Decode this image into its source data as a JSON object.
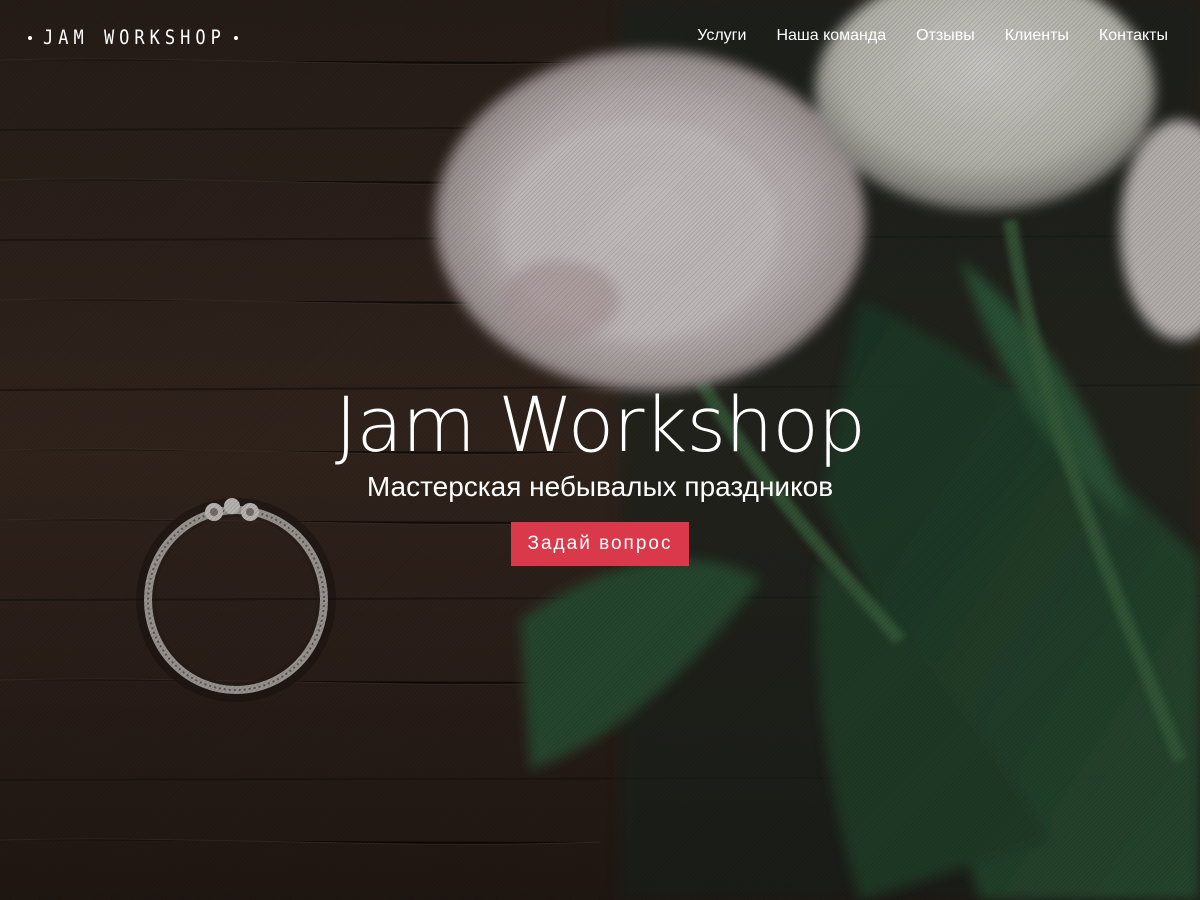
{
  "brand": {
    "logo_text": "JAM WORKSHOP"
  },
  "nav": {
    "items": [
      {
        "label": "Услуги"
      },
      {
        "label": "Наша команда"
      },
      {
        "label": "Отзывы"
      },
      {
        "label": "Клиенты"
      },
      {
        "label": "Контакты"
      }
    ]
  },
  "hero": {
    "title": "Jam Workshop",
    "subtitle": "Мастерская небывалых праздников",
    "cta_label": "Задай вопрос"
  },
  "colors": {
    "accent": "#d9394a",
    "text": "#ffffff",
    "wood": "#3a2a22"
  }
}
